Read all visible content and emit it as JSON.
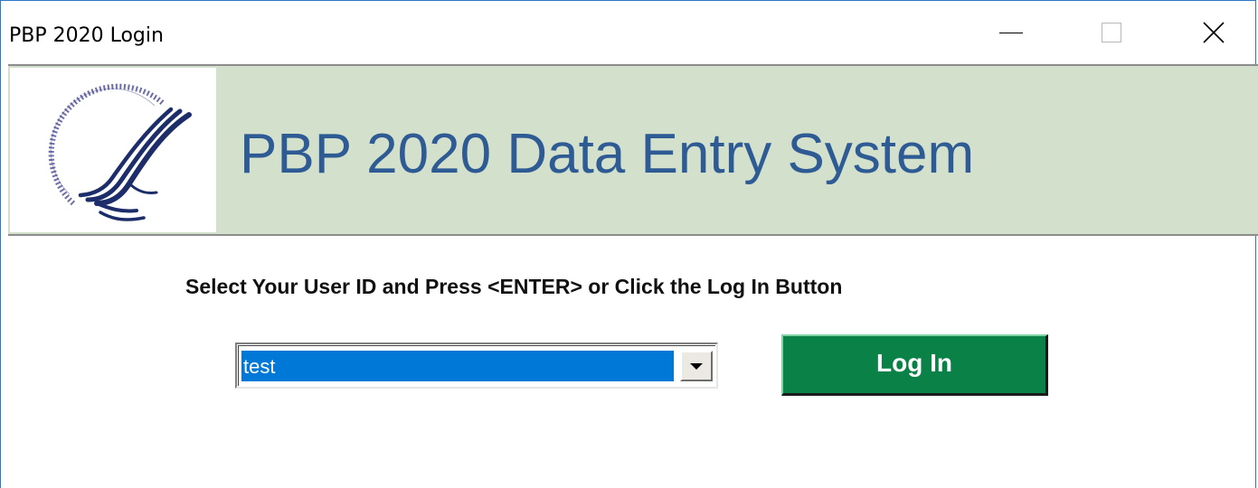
{
  "window": {
    "title": "PBP 2020 Login",
    "controls": {
      "minimize_icon": "minimize-icon",
      "maximize_icon": "maximize-icon",
      "close_icon": "close-icon"
    }
  },
  "banner": {
    "title": "PBP 2020 Data Entry System",
    "logo_icon": "hhs-seal-icon",
    "background_color": "#d3e0cc",
    "title_color": "#2e5b94"
  },
  "form": {
    "instruction": "Select Your User ID and Press <ENTER> or Click the Log In Button",
    "user_select": {
      "selected_value": "test",
      "highlight_color": "#0078d7"
    },
    "login_button": {
      "label": "Log In",
      "color": "#0a8146"
    }
  }
}
